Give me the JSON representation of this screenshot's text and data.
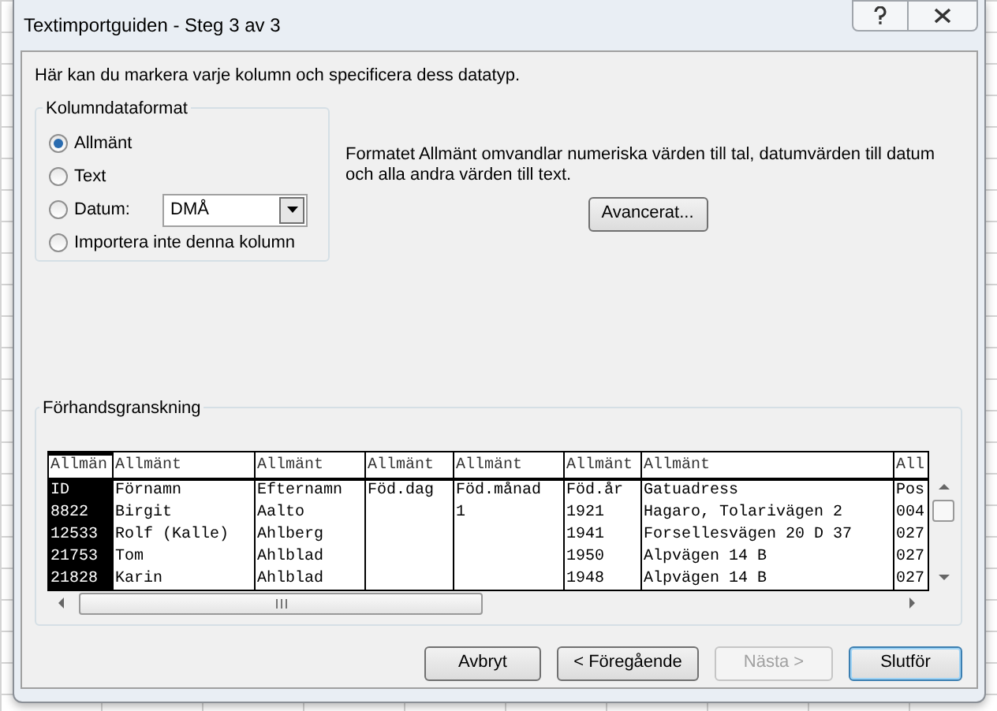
{
  "window": {
    "title": "Textimportguiden - Steg 3 av 3"
  },
  "intro": "Här kan du markera varje kolumn och specificera dess datatyp.",
  "format_group": {
    "title": "Kolumndataformat",
    "options": [
      {
        "kind": "radio",
        "label": "Allmänt",
        "selected": true
      },
      {
        "kind": "radio",
        "label": "Text",
        "selected": false
      },
      {
        "kind": "date",
        "label": "Datum:",
        "selected": false,
        "value": "DMÅ"
      },
      {
        "kind": "radio",
        "label": "Importera inte denna kolumn",
        "selected": false
      }
    ]
  },
  "description": "Formatet Allmänt omvandlar numeriska värden till tal, datumvärden till datum och alla andra värden till text.",
  "advanced_button": "Avancerat...",
  "preview": {
    "title": "Förhandsgranskning",
    "columns": [
      {
        "header": "Allmän",
        "selected": true
      },
      {
        "header": "Allmänt",
        "selected": false
      },
      {
        "header": "Allmänt",
        "selected": false
      },
      {
        "header": "Allmänt",
        "selected": false
      },
      {
        "header": "Allmänt",
        "selected": false
      },
      {
        "header": "Allmänt",
        "selected": false
      },
      {
        "header": "Allmänt",
        "selected": false
      },
      {
        "header": "All",
        "selected": false
      }
    ],
    "rows": [
      [
        "ID",
        "Förnamn",
        "Efternamn",
        "Föd.dag",
        "Föd.månad",
        "Föd.år",
        "Gatuadress",
        "Pos"
      ],
      [
        "8822",
        "Birgit",
        "Aalto",
        "",
        "1",
        "1921",
        "Hagaro, Tolarivägen 2",
        "004"
      ],
      [
        "12533",
        "Rolf (Kalle)",
        "Ahlberg",
        "",
        "",
        "1941",
        "Forsellesvägen 20 D 37",
        "027"
      ],
      [
        "21753",
        "Tom",
        "Ahlblad",
        "",
        "",
        "1950",
        "Alpvägen 14 B",
        "027"
      ],
      [
        "21828",
        "Karin",
        "Ahlblad",
        "",
        "",
        "1948",
        "Alpvägen 14 B",
        "027"
      ]
    ]
  },
  "buttons": [
    {
      "label": "Avbryt",
      "disabled": false,
      "default": false
    },
    {
      "label": "< Föregående",
      "disabled": false,
      "default": false
    },
    {
      "label": "Nästa >",
      "disabled": true,
      "default": false
    },
    {
      "label": "Slutför",
      "disabled": false,
      "default": true
    }
  ]
}
